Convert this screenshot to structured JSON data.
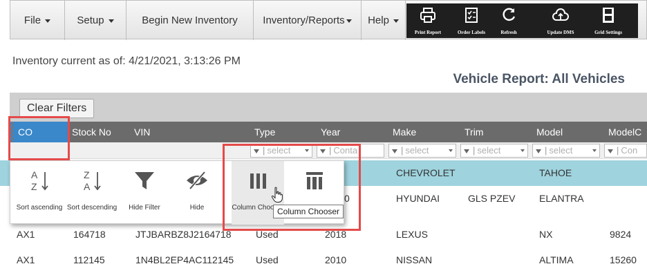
{
  "menu": {
    "file": "File",
    "setup": "Setup",
    "begin_inventory": "Begin New Inventory",
    "inventory_reports": "Inventory/Reports",
    "help": "Help"
  },
  "toolbar": {
    "print_report": "Print Report",
    "order_labels": "Order Labels",
    "refresh": "Refresh",
    "update_dms": "Update DMS",
    "grid_settings": "Grid Settings"
  },
  "info": {
    "as_of": "Inventory current as of: 4/21/2021, 3:13:26 PM",
    "report_title": "Vehicle Report: All Vehicles"
  },
  "filters": {
    "clear_label": "Clear Filters"
  },
  "grid": {
    "columns": [
      "CO",
      "Stock No",
      "VIN",
      "Type",
      "Year",
      "Make",
      "Trim",
      "Model",
      "ModelC"
    ],
    "filter_placeholders": {
      "year": "Conta",
      "select": "select",
      "modelc": "Con"
    },
    "rows": [
      {
        "co": "",
        "stock": "",
        "vin": "",
        "type": "",
        "year": "5",
        "make": "CHEVROLET",
        "trim": "",
        "model": "TAHOE",
        "modelc": ""
      },
      {
        "co": "",
        "stock": "",
        "vin": "",
        "type": "",
        "year": "0",
        "make": "HYUNDAI",
        "trim": "GLS PZEV",
        "model": "ELANTRA",
        "modelc": ""
      },
      {
        "co": "AX1",
        "stock": "164718",
        "vin": "JTJBARBZ8J2164718",
        "type": "Used",
        "year": "2018",
        "make": "LEXUS",
        "trim": "",
        "model": "NX",
        "modelc": "9824"
      },
      {
        "co": "AX1",
        "stock": "112145",
        "vin": "1N4BL2EP4AC112145",
        "type": "Used",
        "year": "2010",
        "make": "NISSAN",
        "trim": "",
        "model": "ALTIMA",
        "modelc": "15260"
      }
    ]
  },
  "context_menu": {
    "sort_ascending": "Sort ascending",
    "sort_descending": "Sort descending",
    "hide_filter": "Hide Filter",
    "hide": "Hide",
    "column_chooser": "Column Chooser",
    "tooltip": "Column Chooser"
  },
  "colors": {
    "selected_header": "#3a87c9",
    "header_bg": "#6b6b6b",
    "row_highlight": "#9fd3de",
    "annotation": "#e54a4a"
  }
}
